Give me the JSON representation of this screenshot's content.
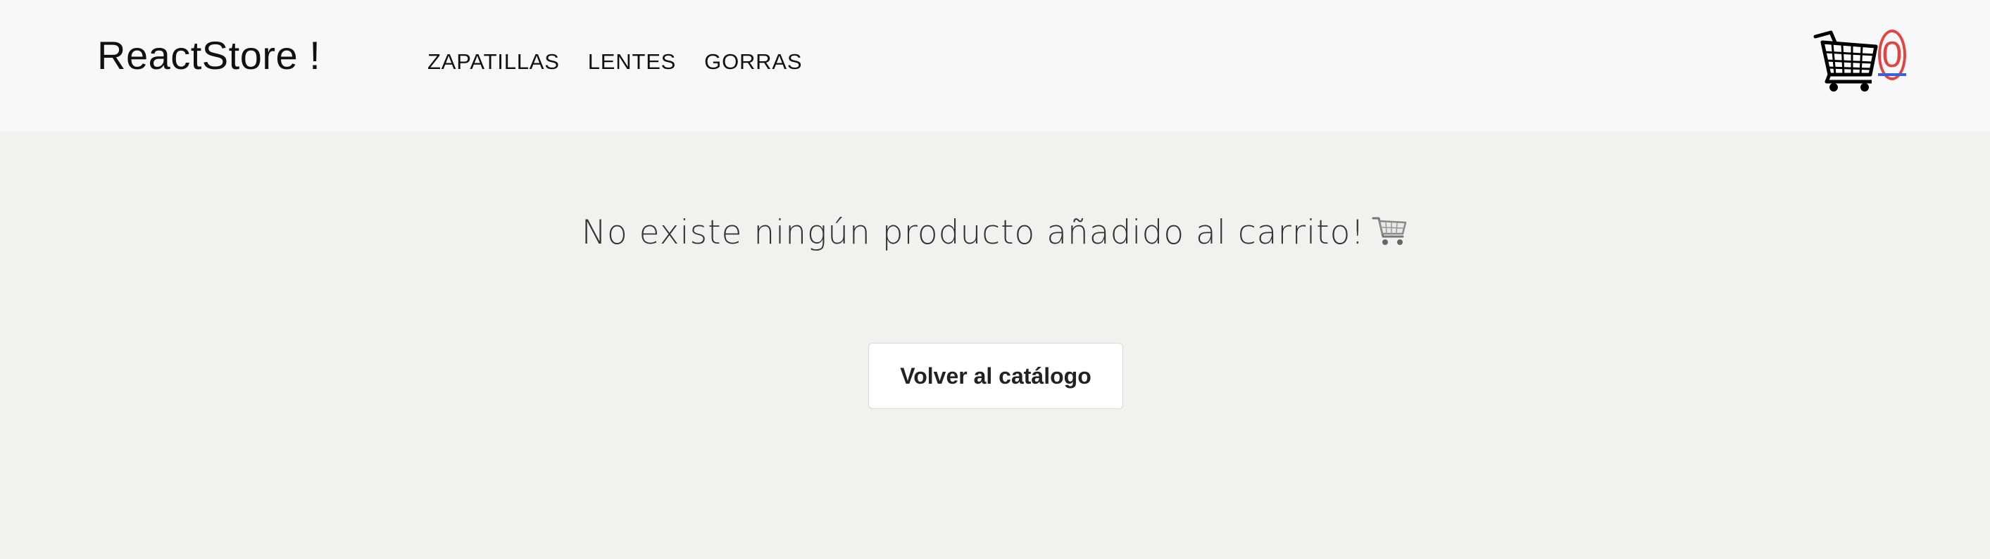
{
  "navbar": {
    "brand": "ReactStore !",
    "links": [
      {
        "label": "ZAPATILLAS"
      },
      {
        "label": "LENTES"
      },
      {
        "label": "GORRAS"
      }
    ],
    "cart": {
      "icon": "shopping-cart-icon",
      "count": "0",
      "count_color": "#e0463f",
      "underline_color": "#3a62d8"
    }
  },
  "main": {
    "empty_message": "No existe ningún producto añadido al carrito!",
    "empty_message_icon": "shopping-cart-emoji",
    "back_button_label": "Volver al catálogo"
  },
  "colors": {
    "navbar_bg": "#f7f8fa",
    "page_bg": "#f2f1ed"
  }
}
